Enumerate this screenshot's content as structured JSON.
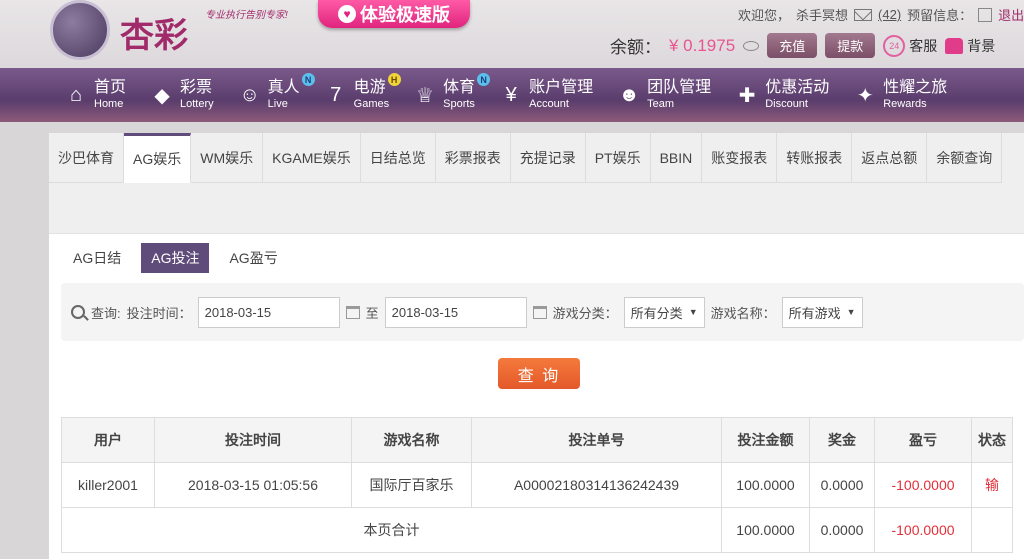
{
  "brand": {
    "name": "杏彩",
    "slogan": "专业执行告别专家!"
  },
  "promo": {
    "icon_glyph": "♥",
    "label": "体验极速版"
  },
  "user": {
    "welcome": "欢迎您，",
    "username": "杀手冥想",
    "msg_count": "(42)",
    "warning_label": "预留信息：",
    "logout": "退出"
  },
  "balance": {
    "label": "余额：",
    "value": "¥ 0.1975",
    "deposit": "充值",
    "withdraw": "提款"
  },
  "service": {
    "cs_label": "客服",
    "cs_icon": "24",
    "bg_label": "背景"
  },
  "nav": [
    {
      "cn": "首页",
      "en": "Home",
      "icon": "home-icon",
      "glyph": "⌂"
    },
    {
      "cn": "彩票",
      "en": "Lottery",
      "icon": "lottery-ticket-icon",
      "glyph": "◆"
    },
    {
      "cn": "真人",
      "en": "Live",
      "icon": "live-dealer-icon",
      "glyph": "☺",
      "badge": "N"
    },
    {
      "cn": "电游",
      "en": "Games",
      "icon": "slot-seven-icon",
      "glyph": "7",
      "badge": "H"
    },
    {
      "cn": "体育",
      "en": "Sports",
      "icon": "trophy-icon",
      "glyph": "♕",
      "badge": "N"
    },
    {
      "cn": "账户管理",
      "en": "Account",
      "icon": "account-icon",
      "glyph": "¥"
    },
    {
      "cn": "团队管理",
      "en": "Team",
      "icon": "team-icon",
      "glyph": "☻"
    },
    {
      "cn": "优惠活动",
      "en": "Discount",
      "icon": "gift-icon",
      "glyph": "✚"
    },
    {
      "cn": "性耀之旅",
      "en": "Rewards",
      "icon": "rewards-icon",
      "glyph": "✦"
    }
  ],
  "tabs": [
    "沙巴体育",
    "AG娱乐",
    "WM娱乐",
    "KGAME娱乐",
    "日结总览",
    "彩票报表",
    "充提记录",
    "PT娱乐",
    "BBIN",
    "账变报表",
    "转账报表",
    "返点总额",
    "余额查询"
  ],
  "subtabs": [
    "AG日结",
    "AG投注",
    "AG盈亏"
  ],
  "query": {
    "label": "查询:",
    "time_label": "投注时间：",
    "start_date": "2018-03-15",
    "to": "至",
    "end_date": "2018-03-15",
    "category_label": "游戏分类：",
    "category_value": "所有分类",
    "game_label": "游戏名称：",
    "game_value": "所有游戏",
    "button": "查 询"
  },
  "table": {
    "headers": [
      "用户",
      "投注时间",
      "游戏名称",
      "投注单号",
      "投注金额",
      "奖金",
      "盈亏",
      "状态"
    ],
    "rows": [
      [
        "killer2001",
        "2018-03-15 01:05:56",
        "国际厅百家乐",
        "A00002180314136242439",
        "100.0000",
        "0.0000",
        "-100.0000",
        "输"
      ]
    ],
    "footer": {
      "label": "本页合计",
      "bet": "100.0000",
      "bonus": "0.0000",
      "pnl": "-100.0000"
    }
  }
}
